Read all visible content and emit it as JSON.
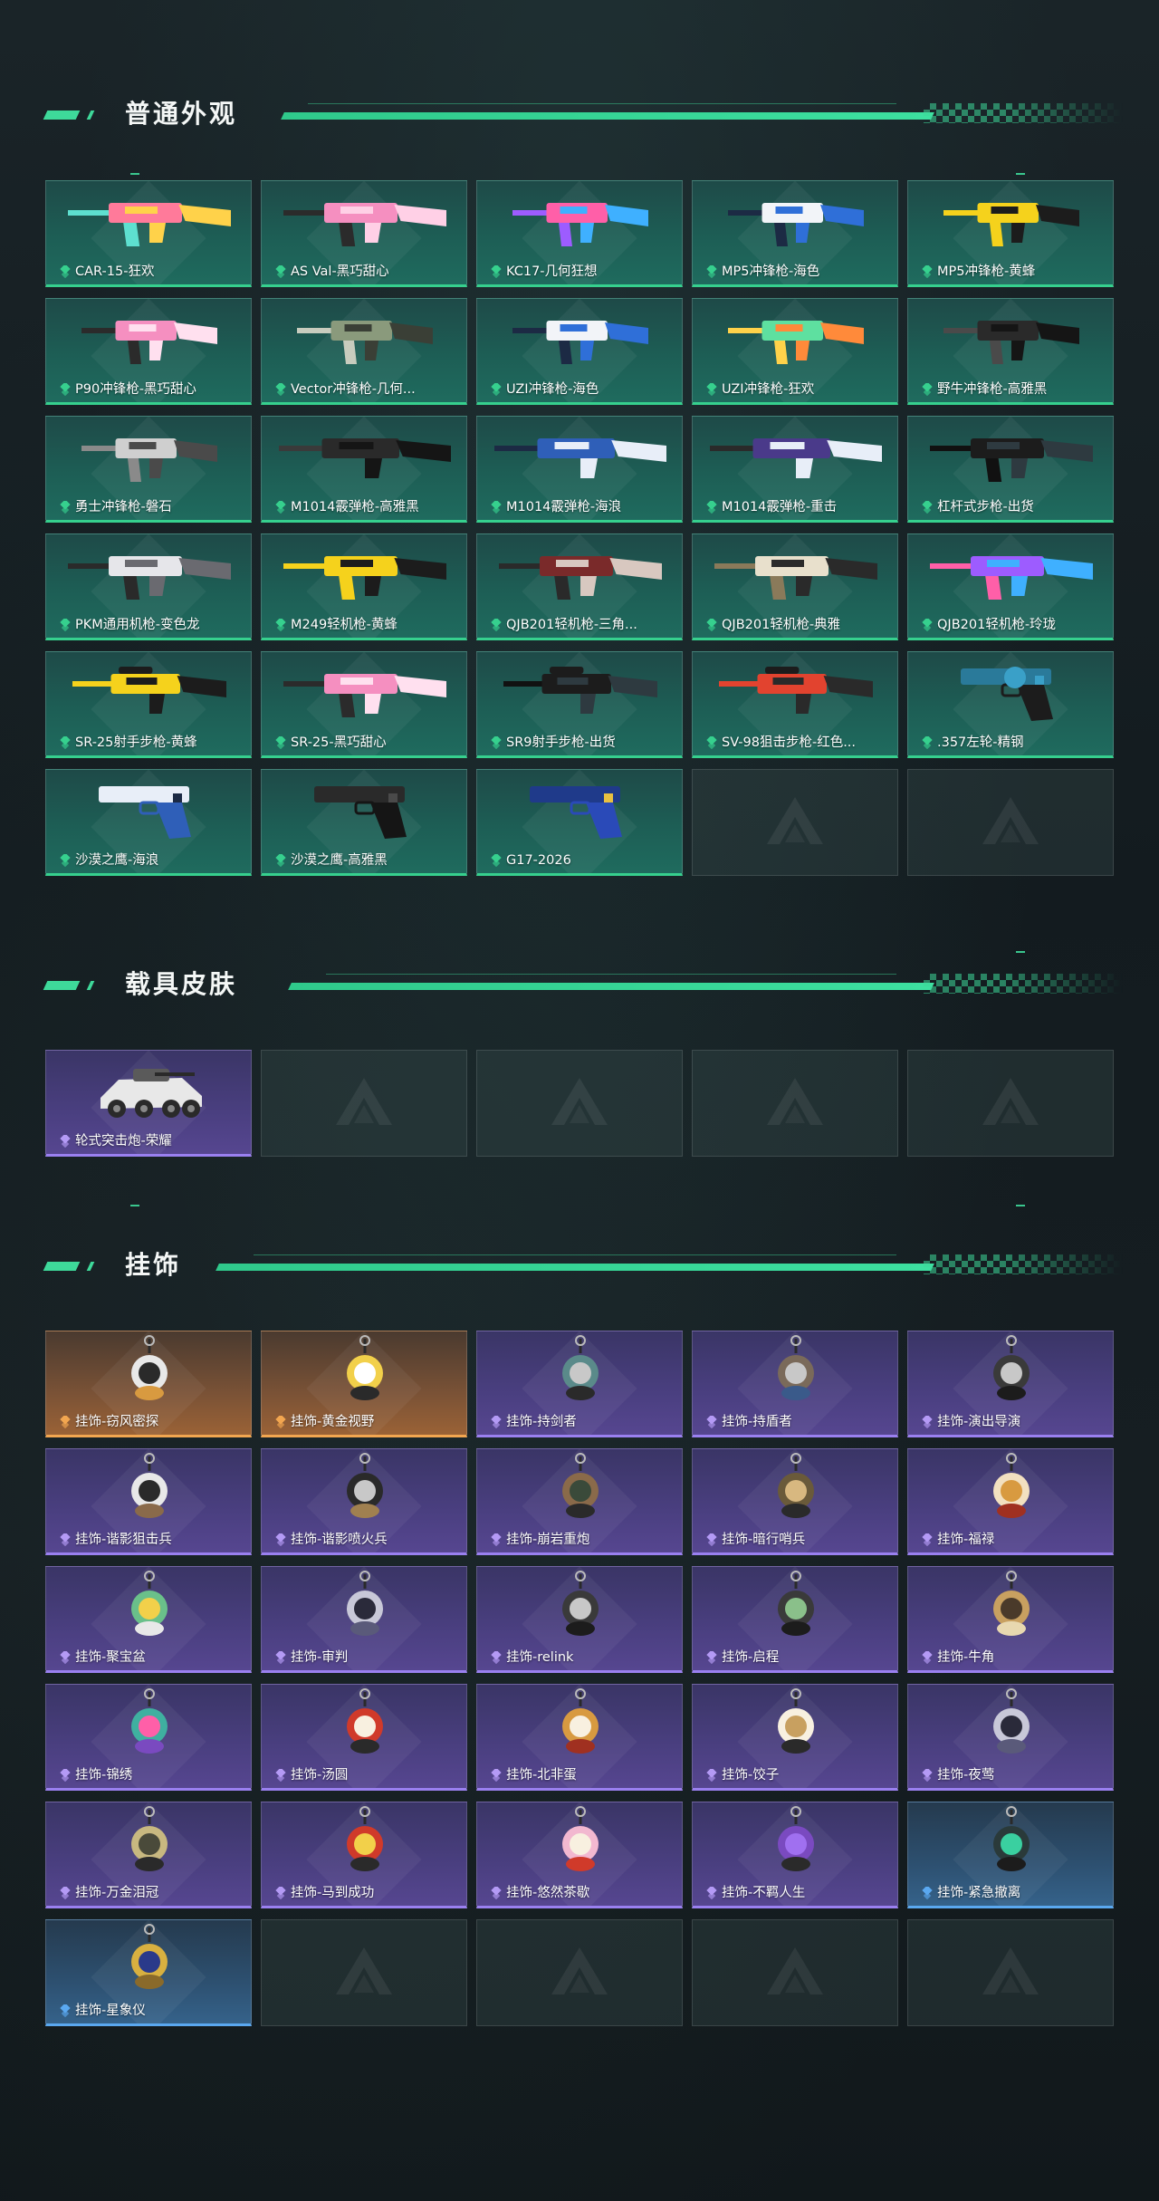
{
  "sections": [
    {
      "title": "普通外观"
    },
    {
      "title": "载具皮肤"
    },
    {
      "title": "挂饰"
    }
  ],
  "weapons": [
    {
      "name": "CAR-15-狂欢",
      "icon": "rifle-icon",
      "tone": "green",
      "colors": [
        "#ff7a9a",
        "#ffd24a",
        "#5ee0d0"
      ]
    },
    {
      "name": "AS Val-黑巧甜心",
      "icon": "rifle-icon",
      "tone": "green",
      "colors": [
        "#f58fc0",
        "#ffd0e6",
        "#2b2b2b"
      ]
    },
    {
      "name": "KC17-几何狂想",
      "icon": "smg-icon",
      "tone": "green",
      "colors": [
        "#ff5fa8",
        "#3fb0ff",
        "#9d5cff"
      ]
    },
    {
      "name": "MP5冲锋枪-海色",
      "icon": "smg-icon",
      "tone": "green",
      "colors": [
        "#f2f4f8",
        "#2f6fd8",
        "#1c2a44"
      ]
    },
    {
      "name": "MP5冲锋枪-黄蜂",
      "icon": "smg-icon",
      "tone": "green",
      "colors": [
        "#f5d21c",
        "#1c1c1c",
        "#f5d21c"
      ]
    },
    {
      "name": "P90冲锋枪-黑巧甜心",
      "icon": "smg-icon",
      "tone": "green",
      "colors": [
        "#f58fc0",
        "#ffe0ef",
        "#2b2b2b"
      ]
    },
    {
      "name": "Vector冲锋枪-几何...",
      "icon": "smg-icon",
      "tone": "green",
      "colors": [
        "#8a9a7c",
        "#3a3f36",
        "#c8ccbe"
      ]
    },
    {
      "name": "UZI冲锋枪-海色",
      "icon": "smg-icon",
      "tone": "green",
      "colors": [
        "#f2f4f8",
        "#2f6fd8",
        "#1c2a44"
      ]
    },
    {
      "name": "UZI冲锋枪-狂欢",
      "icon": "smg-icon",
      "tone": "green",
      "colors": [
        "#5ee0a0",
        "#ff8a3a",
        "#ffd24a"
      ]
    },
    {
      "name": "野牛冲锋枪-高雅黑",
      "icon": "smg-icon",
      "tone": "green",
      "colors": [
        "#2a2a2a",
        "#151515",
        "#4a4a4a"
      ]
    },
    {
      "name": "勇士冲锋枪-磐石",
      "icon": "smg-icon",
      "tone": "green",
      "colors": [
        "#cfcfcf",
        "#4a4a4a",
        "#8a8a8a"
      ]
    },
    {
      "name": "M1014霰弹枪-高雅黑",
      "icon": "shotgun-icon",
      "tone": "green",
      "colors": [
        "#2a2a2a",
        "#151515",
        "#3a3a3a"
      ]
    },
    {
      "name": "M1014霰弹枪-海浪",
      "icon": "shotgun-icon",
      "tone": "green",
      "colors": [
        "#2f5fb8",
        "#e8eef8",
        "#1c2a44"
      ]
    },
    {
      "name": "M1014霰弹枪-重击",
      "icon": "shotgun-icon",
      "tone": "green",
      "colors": [
        "#4a3a8a",
        "#e8eef8",
        "#2a2a2a"
      ]
    },
    {
      "name": "杠杆式步枪-出货",
      "icon": "rifle-icon",
      "tone": "green",
      "colors": [
        "#1c1c1c",
        "#2e3a40",
        "#111"
      ]
    },
    {
      "name": "PKM通用机枪-变色龙",
      "icon": "machine-gun-icon",
      "tone": "green",
      "colors": [
        "#e6e6ea",
        "#6a6a70",
        "#2a2a2a"
      ]
    },
    {
      "name": "M249轻机枪-黄蜂",
      "icon": "machine-gun-icon",
      "tone": "green",
      "colors": [
        "#f5d21c",
        "#1c1c1c",
        "#f5d21c"
      ]
    },
    {
      "name": "QJB201轻机枪-三角...",
      "icon": "machine-gun-icon",
      "tone": "green",
      "colors": [
        "#7a2a2a",
        "#d8c8c0",
        "#2a2a2a"
      ]
    },
    {
      "name": "QJB201轻机枪-典雅",
      "icon": "machine-gun-icon",
      "tone": "green",
      "colors": [
        "#e8e0cc",
        "#2a2a2a",
        "#8a7a5a"
      ]
    },
    {
      "name": "QJB201轻机枪-玲珑",
      "icon": "machine-gun-icon",
      "tone": "green",
      "colors": [
        "#9d5cff",
        "#3fb0ff",
        "#ff5fa8"
      ]
    },
    {
      "name": "SR-25射手步枪-黄蜂",
      "icon": "sniper-icon",
      "tone": "green",
      "colors": [
        "#f5d21c",
        "#1c1c1c",
        "#f5d21c"
      ]
    },
    {
      "name": "SR-25-黑巧甜心",
      "icon": "rifle-icon",
      "tone": "green",
      "colors": [
        "#f58fc0",
        "#ffe0ef",
        "#2b2b2b"
      ]
    },
    {
      "name": "SR9射手步枪-出货",
      "icon": "sniper-icon",
      "tone": "green",
      "colors": [
        "#1c1c1c",
        "#2e3a40",
        "#111"
      ]
    },
    {
      "name": "SV-98狙击步枪-红色...",
      "icon": "sniper-icon",
      "tone": "green",
      "colors": [
        "#e2432f",
        "#2a2a2a",
        "#e2432f"
      ]
    },
    {
      "name": ".357左轮-精钢",
      "icon": "revolver-icon",
      "tone": "green",
      "colors": [
        "#2a7a9a",
        "#1c1c1c",
        "#3aa0c8"
      ]
    },
    {
      "name": "沙漠之鹰-海浪",
      "icon": "pistol-icon",
      "tone": "green",
      "colors": [
        "#e8eef8",
        "#2f5fb8",
        "#1c2a44"
      ]
    },
    {
      "name": "沙漠之鹰-高雅黑",
      "icon": "pistol-icon",
      "tone": "green",
      "colors": [
        "#2a2a2a",
        "#151515",
        "#4a4a4a"
      ]
    },
    {
      "name": "G17-2026",
      "icon": "pistol-icon",
      "tone": "green",
      "colors": [
        "#1f3a8a",
        "#2a4ab8",
        "#e8c040"
      ]
    },
    {
      "name": "",
      "empty": true
    },
    {
      "name": "",
      "empty": true
    }
  ],
  "vehicles": [
    {
      "name": "轮式突击炮-荣耀",
      "icon": "vehicle-icon",
      "tone": "purple",
      "colors": [
        "#e8e8e8",
        "#2a2a2a",
        "#5a5a5a"
      ]
    },
    {
      "name": "",
      "empty": true
    },
    {
      "name": "",
      "empty": true
    },
    {
      "name": "",
      "empty": true
    },
    {
      "name": "",
      "empty": true
    }
  ],
  "charms": [
    {
      "name": "挂饰-窃风密探",
      "icon": "charm-icon",
      "tone": "orange",
      "colors": [
        "#e8e8e8",
        "#2a2a2a",
        "#d89a40"
      ]
    },
    {
      "name": "挂饰-黄金视野",
      "icon": "charm-icon",
      "tone": "orange",
      "colors": [
        "#f2d04a",
        "#ffffff",
        "#2a2a2a"
      ]
    },
    {
      "name": "挂饰-持剑者",
      "icon": "charm-icon",
      "tone": "purple",
      "colors": [
        "#5a8a8a",
        "#c8c8c8",
        "#2a2a2a"
      ]
    },
    {
      "name": "挂饰-持盾者",
      "icon": "charm-icon",
      "tone": "purple",
      "colors": [
        "#7a6a5a",
        "#c8c8c8",
        "#3a5a8a"
      ]
    },
    {
      "name": "挂饰-演出导演",
      "icon": "charm-icon",
      "tone": "purple",
      "colors": [
        "#3a3a3a",
        "#c8c8c8",
        "#1c1c1c"
      ]
    },
    {
      "name": "挂饰-谐影狙击兵",
      "icon": "charm-icon",
      "tone": "purple",
      "colors": [
        "#e8e8e8",
        "#2a2a2a",
        "#8a6a4a"
      ]
    },
    {
      "name": "挂饰-谐影喷火兵",
      "icon": "charm-icon",
      "tone": "purple",
      "colors": [
        "#2a2a2a",
        "#c8c8c8",
        "#a08050"
      ]
    },
    {
      "name": "挂饰-崩岩重炮",
      "icon": "charm-icon",
      "tone": "purple",
      "colors": [
        "#8a6a4a",
        "#3a4a3a",
        "#2a2a2a"
      ]
    },
    {
      "name": "挂饰-暗行哨兵",
      "icon": "charm-icon",
      "tone": "purple",
      "colors": [
        "#6a5a3a",
        "#d8b880",
        "#2a2a2a"
      ]
    },
    {
      "name": "挂饰-福禄",
      "icon": "charm-icon",
      "tone": "purple",
      "colors": [
        "#f2e0c0",
        "#d89a40",
        "#a03020"
      ]
    },
    {
      "name": "挂饰-聚宝盆",
      "icon": "charm-icon",
      "tone": "purple",
      "colors": [
        "#6ac08a",
        "#f2d04a",
        "#e8e8e8"
      ]
    },
    {
      "name": "挂饰-审判",
      "icon": "charm-icon",
      "tone": "purple",
      "colors": [
        "#c8c8d8",
        "#2a2a3a",
        "#5a5a7a"
      ]
    },
    {
      "name": "挂饰-relink",
      "icon": "charm-icon",
      "tone": "purple",
      "colors": [
        "#3a3a3a",
        "#c8c8c8",
        "#1c1c1c"
      ]
    },
    {
      "name": "挂饰-启程",
      "icon": "charm-icon",
      "tone": "purple",
      "colors": [
        "#3a3a3a",
        "#8ac08a",
        "#1c1c1c"
      ]
    },
    {
      "name": "挂饰-牛角",
      "icon": "charm-icon",
      "tone": "purple",
      "colors": [
        "#c8a060",
        "#4a3a2a",
        "#e8d8b0"
      ]
    },
    {
      "name": "挂饰-锦绣",
      "icon": "charm-icon",
      "tone": "purple",
      "colors": [
        "#3fb0a0",
        "#ff5fa8",
        "#7a4ac0"
      ]
    },
    {
      "name": "挂饰-汤圆",
      "icon": "charm-icon",
      "tone": "purple",
      "colors": [
        "#d03a2a",
        "#f8f0e0",
        "#2a2a2a"
      ]
    },
    {
      "name": "挂饰-北非蛋",
      "icon": "charm-icon",
      "tone": "purple",
      "colors": [
        "#d89a40",
        "#f8f0e0",
        "#a03020"
      ]
    },
    {
      "name": "挂饰-饺子",
      "icon": "charm-icon",
      "tone": "purple",
      "colors": [
        "#f8f0e0",
        "#c8a060",
        "#2a2a2a"
      ]
    },
    {
      "name": "挂饰-夜莺",
      "icon": "charm-icon",
      "tone": "purple",
      "colors": [
        "#c8c8d8",
        "#2a2a3a",
        "#5a5a7a"
      ]
    },
    {
      "name": "挂饰-万金泪冠",
      "icon": "charm-icon",
      "tone": "purple",
      "colors": [
        "#c8b880",
        "#4a4a3a",
        "#2a2a2a"
      ]
    },
    {
      "name": "挂饰-马到成功",
      "icon": "charm-icon",
      "tone": "purple",
      "colors": [
        "#d03a2a",
        "#f2d04a",
        "#2a2a2a"
      ]
    },
    {
      "name": "挂饰-悠然茶歇",
      "icon": "charm-icon",
      "tone": "purple",
      "colors": [
        "#f2b8d0",
        "#f8f0e0",
        "#d03a2a"
      ]
    },
    {
      "name": "挂饰-不羁人生",
      "icon": "charm-icon",
      "tone": "purple",
      "colors": [
        "#7a4ac0",
        "#a070f0",
        "#2a2a2a"
      ]
    },
    {
      "name": "挂饰-紧急撤离",
      "icon": "charm-icon",
      "tone": "blue",
      "colors": [
        "#2a3a3a",
        "#3ad0a0",
        "#1c1c1c"
      ]
    },
    {
      "name": "挂饰-星象仪",
      "icon": "charm-icon",
      "tone": "blue",
      "colors": [
        "#d8b040",
        "#2a3a8a",
        "#8a6a2a"
      ]
    },
    {
      "name": "",
      "empty": true
    },
    {
      "name": "",
      "empty": true
    },
    {
      "name": "",
      "empty": true
    },
    {
      "name": "",
      "empty": true
    }
  ],
  "rarity_colors": {
    "green": "#36d08e",
    "purple": "#b49af5",
    "orange": "#f2a650",
    "blue": "#5aa8f0"
  }
}
